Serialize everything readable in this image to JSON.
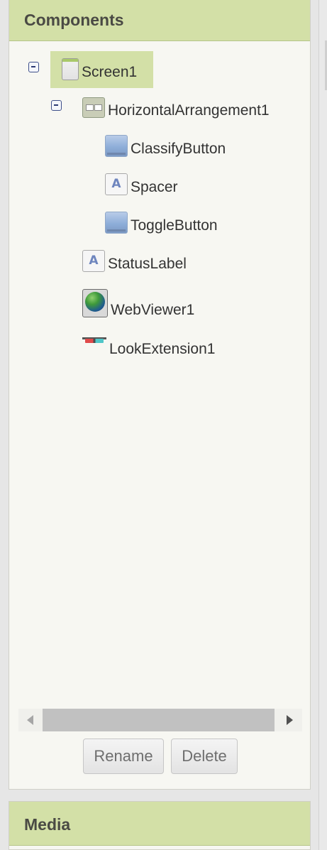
{
  "components_panel": {
    "title": "Components",
    "tree": {
      "screen1": {
        "label": "Screen1",
        "icon": "screen-icon",
        "selected": true,
        "expanded": true
      },
      "horizontal_arrangement1": {
        "label": "HorizontalArrangement1",
        "icon": "horizontal-arrangement-icon",
        "expanded": true
      },
      "classify_button": {
        "label": "ClassifyButton",
        "icon": "button-icon"
      },
      "spacer": {
        "label": "Spacer",
        "icon": "label-icon",
        "glyph": "A"
      },
      "toggle_button": {
        "label": "ToggleButton",
        "icon": "button-icon"
      },
      "status_label": {
        "label": "StatusLabel",
        "icon": "label-icon",
        "glyph": "A"
      },
      "web_viewer1": {
        "label": "WebViewer1",
        "icon": "webviewer-globe-icon"
      },
      "look_extension1": {
        "label": "LookExtension1",
        "icon": "extension-glasses-icon"
      }
    },
    "buttons": {
      "rename": "Rename",
      "delete": "Delete"
    }
  },
  "media_panel": {
    "title": "Media"
  },
  "colors": {
    "header_bg": "#d3e0a7",
    "panel_bg": "#f7f7f2",
    "selected_bg": "#d3e0a7",
    "toggle_border": "#3e4f8a"
  }
}
